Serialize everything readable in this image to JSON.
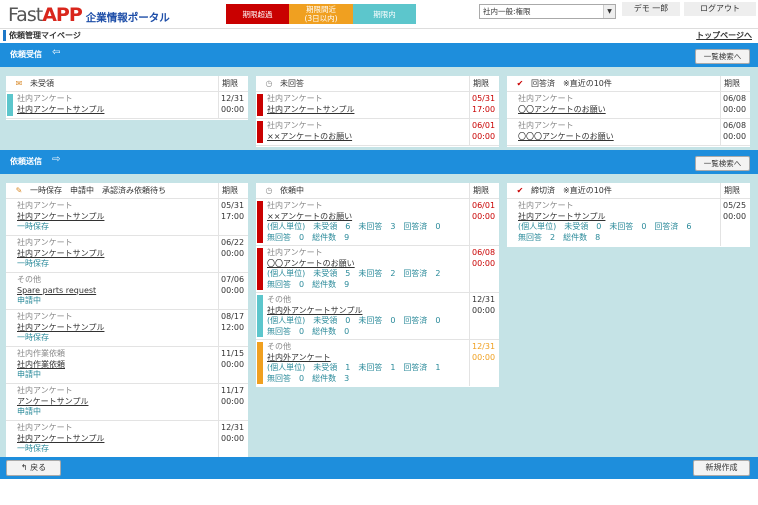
{
  "header": {
    "logo_fast": "Fast",
    "logo_app": "APP",
    "logo_sub": "企業情報ポータル",
    "legend": {
      "overdue": "期限超過",
      "near_line1": "期限間近",
      "near_line2": "(3日以内)",
      "in_term": "期限内"
    },
    "dept_select": "社内一般:権限",
    "user_name": "デモ 一郎",
    "logout": "ログアウト"
  },
  "subheader": {
    "title": "依頼管理マイページ",
    "top_link": "トップページへ"
  },
  "received": {
    "title": "依頼受信",
    "list_button": "一覧検索へ",
    "panels": [
      {
        "title": "未受領",
        "due_header": "期限",
        "rows": [
          {
            "status": "in",
            "category": "社内アンケート",
            "link": "社内アンケートサンプル",
            "due_date": "12/31",
            "due_time": "00:00"
          }
        ]
      },
      {
        "title": "未回答",
        "due_header": "期限",
        "rows": [
          {
            "status": "over",
            "category": "社内アンケート",
            "link": "社内アンケートサンプル",
            "due_date": "05/31",
            "due_time": "17:00"
          },
          {
            "status": "over",
            "category": "社内アンケート",
            "link": "××アンケートのお願い",
            "due_date": "06/01",
            "due_time": "00:00"
          }
        ]
      },
      {
        "title": "回答済　※直近の10件",
        "due_header": "期限",
        "rows": [
          {
            "status": "none",
            "category": "社内アンケート",
            "link": "〇〇アンケートのお願い",
            "due_date": "06/08",
            "due_time": "00:00"
          },
          {
            "status": "none",
            "category": "社内アンケート",
            "link": "〇〇〇アンケートのお願い",
            "due_date": "06/08",
            "due_time": "00:00"
          }
        ]
      }
    ]
  },
  "sent": {
    "title": "依頼送信",
    "list_button": "一覧検索へ",
    "panels": [
      {
        "title": "一時保存　申請中　承認済み依頼待ち",
        "due_header": "期限",
        "rows": [
          {
            "category": "社内アンケート",
            "link": "社内アンケートサンプル",
            "sub": "一時保存",
            "due_date": "05/31",
            "due_time": "17:00"
          },
          {
            "category": "社内アンケート",
            "link": "社内アンケートサンプル",
            "sub": "一時保存",
            "due_date": "06/22",
            "due_time": "00:00"
          },
          {
            "category": "その他",
            "link": "Spare parts request",
            "sub": "申請中",
            "due_date": "07/06",
            "due_time": "00:00"
          },
          {
            "category": "社内アンケート",
            "link": "社内アンケートサンプル",
            "sub": "一時保存",
            "due_date": "08/17",
            "due_time": "12:00"
          },
          {
            "category": "社内作業依頼",
            "link": "社内作業依頼",
            "sub": "申請中",
            "due_date": "11/15",
            "due_time": "00:00"
          },
          {
            "category": "社内アンケート",
            "link": "アンケートサンプル",
            "sub": "申請中",
            "due_date": "11/17",
            "due_time": "00:00"
          },
          {
            "category": "社内アンケート",
            "link": "社内アンケートサンプル",
            "sub": "一時保存",
            "due_date": "12/31",
            "due_time": "00:00"
          }
        ]
      },
      {
        "title": "依頼中",
        "due_header": "期限",
        "rows": [
          {
            "status": "over",
            "category": "社内アンケート",
            "link": "××アンケートのお願い",
            "stat1": "(個人単位)　未受領　6　未回答　3　回答済　0",
            "stat2": "無回答　0　総件数　9",
            "due_date": "06/01",
            "due_time": "00:00"
          },
          {
            "status": "over",
            "category": "社内アンケート",
            "link": "〇〇アンケートのお願い",
            "stat1": "(個人単位)　未受領　5　未回答　2　回答済　2",
            "stat2": "無回答　0　総件数　9",
            "due_date": "06/08",
            "due_time": "00:00"
          },
          {
            "status": "in",
            "category": "その他",
            "link": "社内外アンケートサンプル",
            "stat1": "(個人単位)　未受領　0　未回答　0　回答済　0",
            "stat2": "無回答　0　総件数　0",
            "due_date": "12/31",
            "due_time": "00:00"
          },
          {
            "status": "near",
            "category": "その他",
            "link": "社内外アンケート",
            "stat1": "(個人単位)　未受領　1　未回答　1　回答済　1",
            "stat2": "無回答　0　総件数　3",
            "due_date": "12/31",
            "due_time": "00:00"
          }
        ]
      },
      {
        "title": "締切済　※直近の10件",
        "due_header": "期限",
        "rows": [
          {
            "category": "社内アンケート",
            "link": "社内アンケートサンプル",
            "stat1": "(個人単位)　未受領　0　未回答　0　回答済　6",
            "stat2": "無回答　2　総件数　8",
            "due_date": "05/25",
            "due_time": "00:00"
          }
        ]
      }
    ]
  },
  "footer": {
    "back": "戻る",
    "new": "新規作成"
  },
  "colors": {
    "overdue": "#c90000",
    "near": "#f0a020",
    "in_term": "#5cc6cc",
    "section_bar": "#1e8edc",
    "section_bg": "#c5e3e6"
  },
  "icons": {
    "unreceived": "envelope-icon",
    "unanswered": "clock-icon",
    "answered": "check-icon",
    "draft": "pencil-icon",
    "requesting": "clock-icon",
    "closed": "check-icon",
    "back": "back-arrow-icon"
  }
}
